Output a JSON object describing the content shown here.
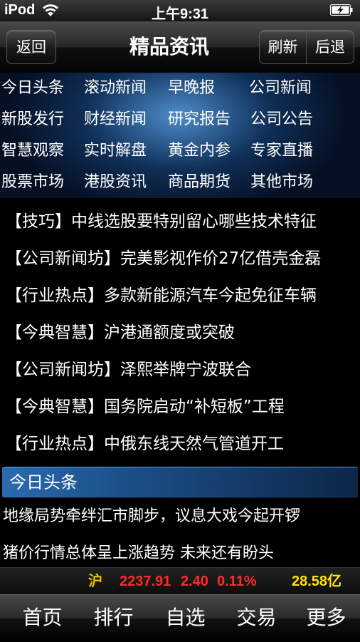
{
  "status": {
    "carrier": "iPod",
    "time": "上午9:31",
    "icons": [
      "wifi-icon",
      "battery-charging-icon"
    ]
  },
  "nav": {
    "title": "精品资讯",
    "back": "返回",
    "refresh": "刷新",
    "previous": "后退"
  },
  "categories": [
    [
      "今日头条",
      "滚动新闻",
      "早晚报",
      "公司新闻"
    ],
    [
      "新股发行",
      "财经新闻",
      "研究报告",
      "公司公告"
    ],
    [
      "智慧观察",
      "实时解盘",
      "黄金内参",
      "专家直播"
    ],
    [
      "股票市场",
      "港股资讯",
      "商品期货",
      "其他市场"
    ]
  ],
  "news": [
    "【技巧】中线选股要特别留心哪些技术特征",
    "【公司新闻坊】完美影视作价27亿借壳金磊",
    "【行业热点】多款新能源汽车今起免征车辆",
    "【今典智慧】沪港通额度或突破",
    "【公司新闻坊】泽熙举牌宁波联合",
    "【今典智慧】国务院启动“补短板”工程",
    "【行业热点】中俄东线天然气管道开工"
  ],
  "today": {
    "title": "今日头条",
    "items": [
      "地缘局势牵绊汇市脚步，议息大戏今起开锣",
      "猪价行情总体呈上涨趋势 未来还有盼头"
    ]
  },
  "ticker": {
    "market": "沪",
    "index": "2237.91",
    "change": "2.40",
    "percent": "0.11%",
    "volume": "28.58亿"
  },
  "tabs": [
    "首页",
    "排行",
    "自选",
    "交易",
    "更多"
  ],
  "colors": {
    "ticker_up": "#ff2a2a",
    "ticker_market": "#e8c000",
    "ticker_volume": "#ffe600",
    "accent_blue": "#2a6ab0"
  }
}
